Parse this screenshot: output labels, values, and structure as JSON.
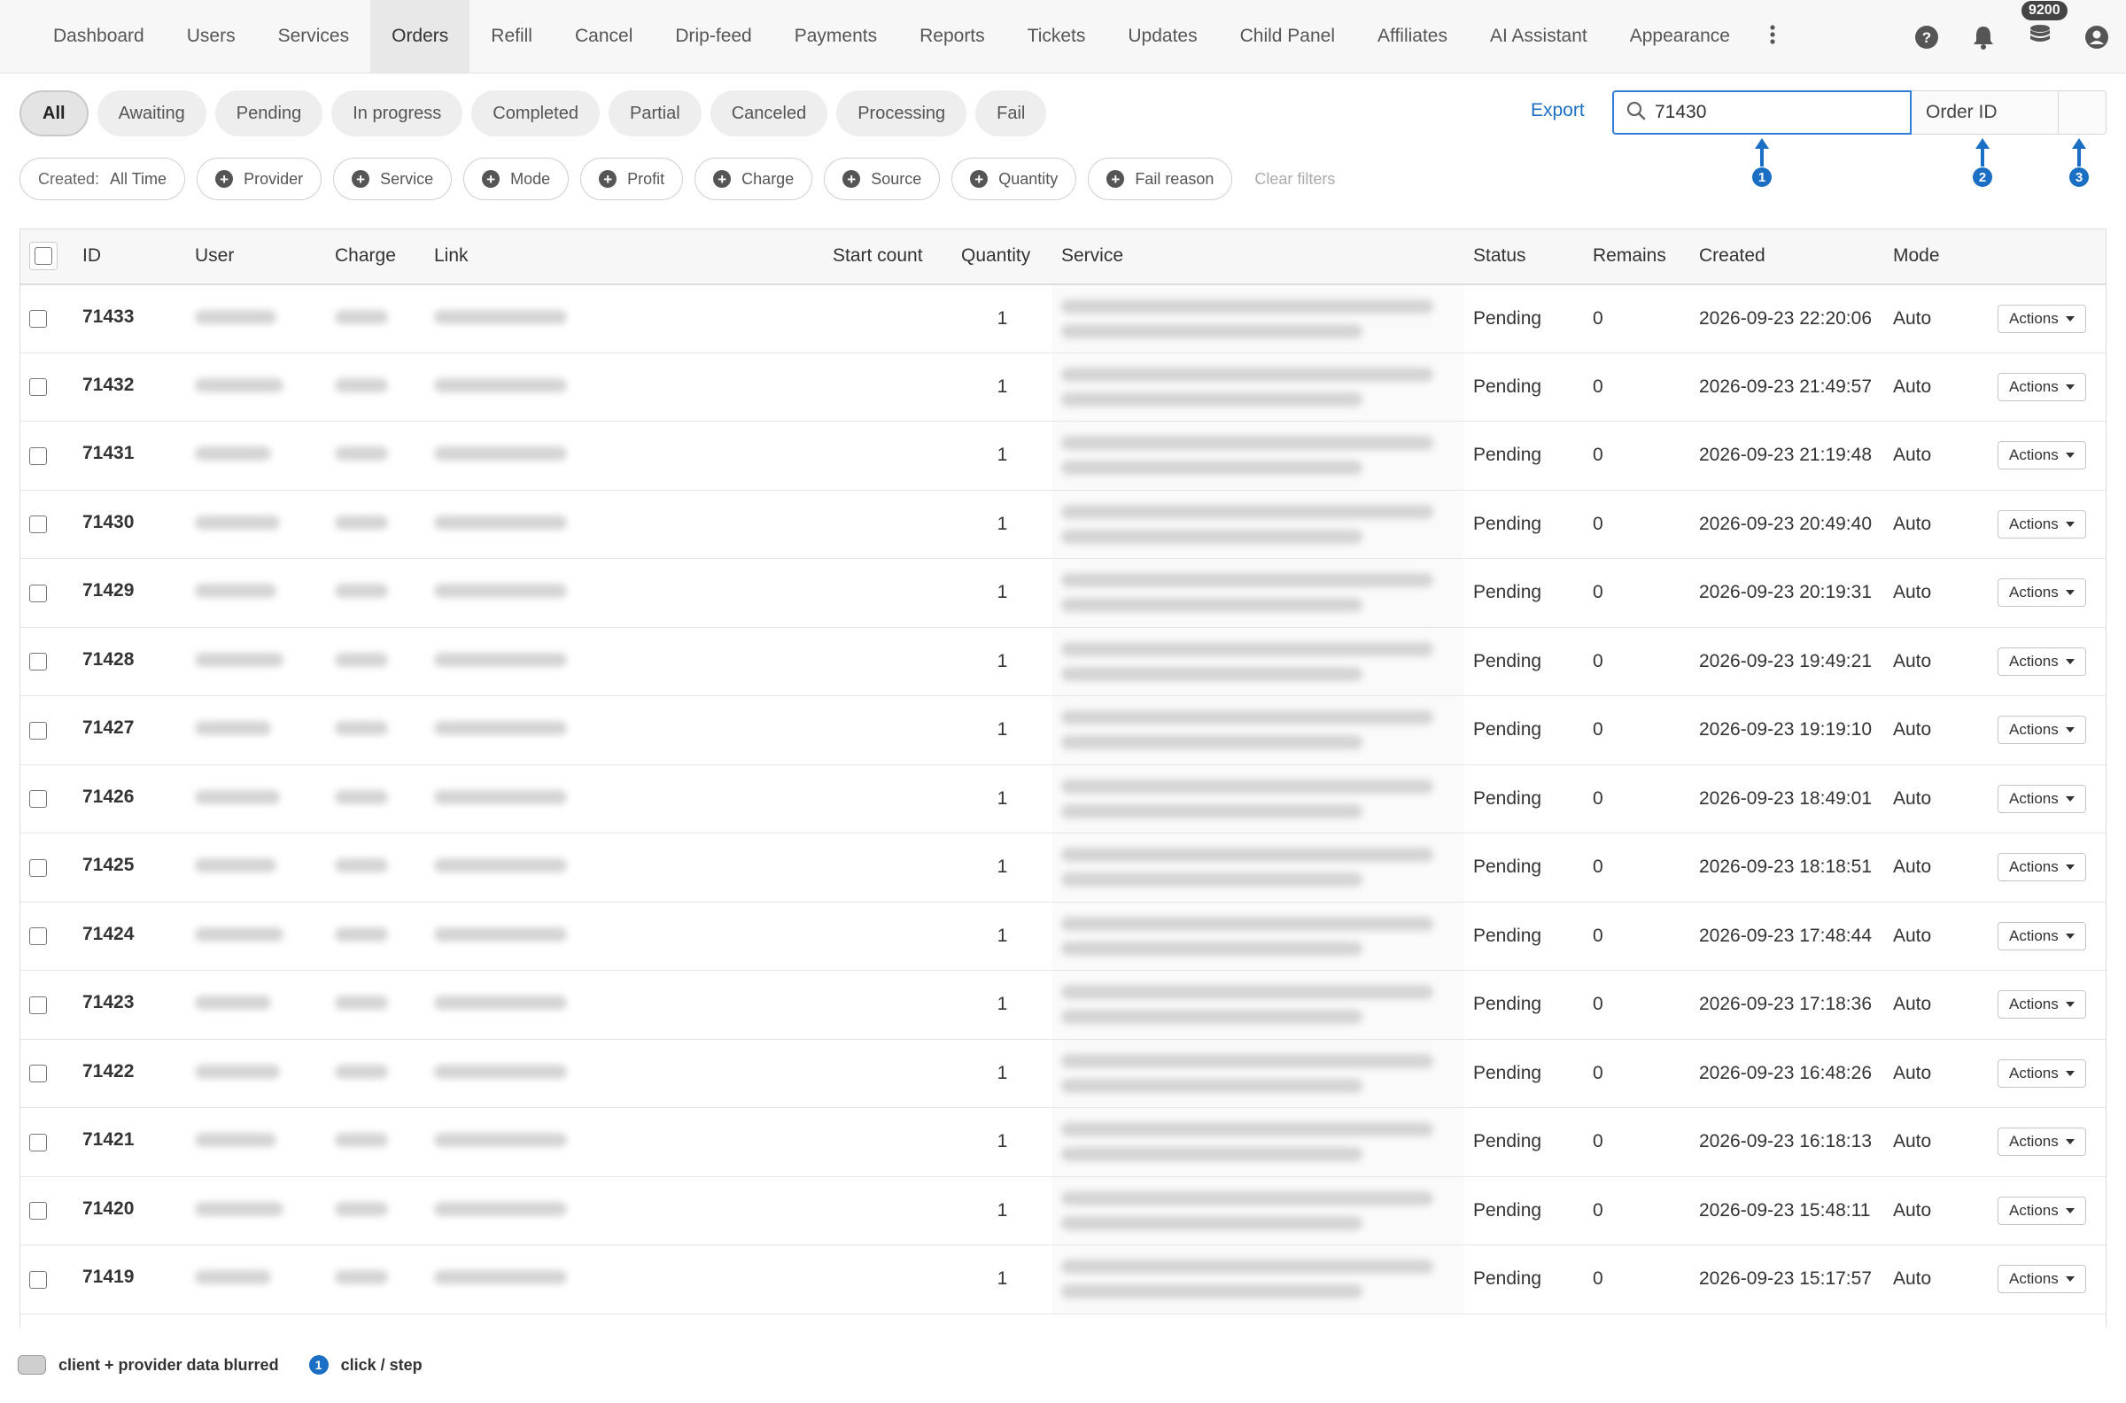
{
  "nav": {
    "items": [
      "Dashboard",
      "Users",
      "Services",
      "Orders",
      "Refill",
      "Cancel",
      "Drip-feed",
      "Payments",
      "Reports",
      "Tickets",
      "Updates",
      "Child Panel",
      "Affiliates",
      "AI Assistant",
      "Appearance"
    ],
    "active": "Orders",
    "balance": "9200",
    "icons": [
      "more-vertical-icon",
      "help-icon",
      "bell-icon",
      "coins-icon",
      "user-icon"
    ]
  },
  "tabs": [
    "All",
    "Awaiting",
    "Pending",
    "In progress",
    "Completed",
    "Partial",
    "Canceled",
    "Processing",
    "Fail"
  ],
  "active_tab": "All",
  "search": {
    "export_label": "Export",
    "value": "71430",
    "type": "Order ID"
  },
  "markers": [
    "1",
    "2",
    "3"
  ],
  "filters": {
    "created_label": "Created:",
    "created_value": "All Time",
    "chips": [
      "Provider",
      "Service",
      "Mode",
      "Profit",
      "Charge",
      "Source",
      "Quantity",
      "Fail reason"
    ],
    "clear_label": "Clear filters"
  },
  "table": {
    "headers": [
      "ID",
      "User",
      "Charge",
      "Link",
      "Start count",
      "Quantity",
      "Service",
      "Status",
      "Remains",
      "Created",
      "Mode"
    ],
    "action_label": "Actions",
    "rows": [
      {
        "id": "71433",
        "quantity": "1",
        "status": "Pending",
        "remains": "0",
        "created": "2026-09-23 22:20:06",
        "mode": "Auto"
      },
      {
        "id": "71432",
        "quantity": "1",
        "status": "Pending",
        "remains": "0",
        "created": "2026-09-23 21:49:57",
        "mode": "Auto"
      },
      {
        "id": "71431",
        "quantity": "1",
        "status": "Pending",
        "remains": "0",
        "created": "2026-09-23 21:19:48",
        "mode": "Auto"
      },
      {
        "id": "71430",
        "quantity": "1",
        "status": "Pending",
        "remains": "0",
        "created": "2026-09-23 20:49:40",
        "mode": "Auto"
      },
      {
        "id": "71429",
        "quantity": "1",
        "status": "Pending",
        "remains": "0",
        "created": "2026-09-23 20:19:31",
        "mode": "Auto"
      },
      {
        "id": "71428",
        "quantity": "1",
        "status": "Pending",
        "remains": "0",
        "created": "2026-09-23 19:49:21",
        "mode": "Auto"
      },
      {
        "id": "71427",
        "quantity": "1",
        "status": "Pending",
        "remains": "0",
        "created": "2026-09-23 19:19:10",
        "mode": "Auto"
      },
      {
        "id": "71426",
        "quantity": "1",
        "status": "Pending",
        "remains": "0",
        "created": "2026-09-23 18:49:01",
        "mode": "Auto"
      },
      {
        "id": "71425",
        "quantity": "1",
        "status": "Pending",
        "remains": "0",
        "created": "2026-09-23 18:18:51",
        "mode": "Auto"
      },
      {
        "id": "71424",
        "quantity": "1",
        "status": "Pending",
        "remains": "0",
        "created": "2026-09-23 17:48:44",
        "mode": "Auto"
      },
      {
        "id": "71423",
        "quantity": "1",
        "status": "Pending",
        "remains": "0",
        "created": "2026-09-23 17:18:36",
        "mode": "Auto"
      },
      {
        "id": "71422",
        "quantity": "1",
        "status": "Pending",
        "remains": "0",
        "created": "2026-09-23 16:48:26",
        "mode": "Auto"
      },
      {
        "id": "71421",
        "quantity": "1",
        "status": "Pending",
        "remains": "0",
        "created": "2026-09-23 16:18:13",
        "mode": "Auto"
      },
      {
        "id": "71420",
        "quantity": "1",
        "status": "Pending",
        "remains": "0",
        "created": "2026-09-23 15:48:11",
        "mode": "Auto"
      },
      {
        "id": "71419",
        "quantity": "1",
        "status": "Pending",
        "remains": "0",
        "created": "2026-09-23 15:17:57",
        "mode": "Auto"
      }
    ]
  },
  "legend": {
    "blurred_label": "client + provider data blurred",
    "step_number": "1",
    "step_label": "click / step"
  },
  "colors": {
    "accent": "#1a6fc4",
    "nav_bg": "#f7f7f7"
  }
}
